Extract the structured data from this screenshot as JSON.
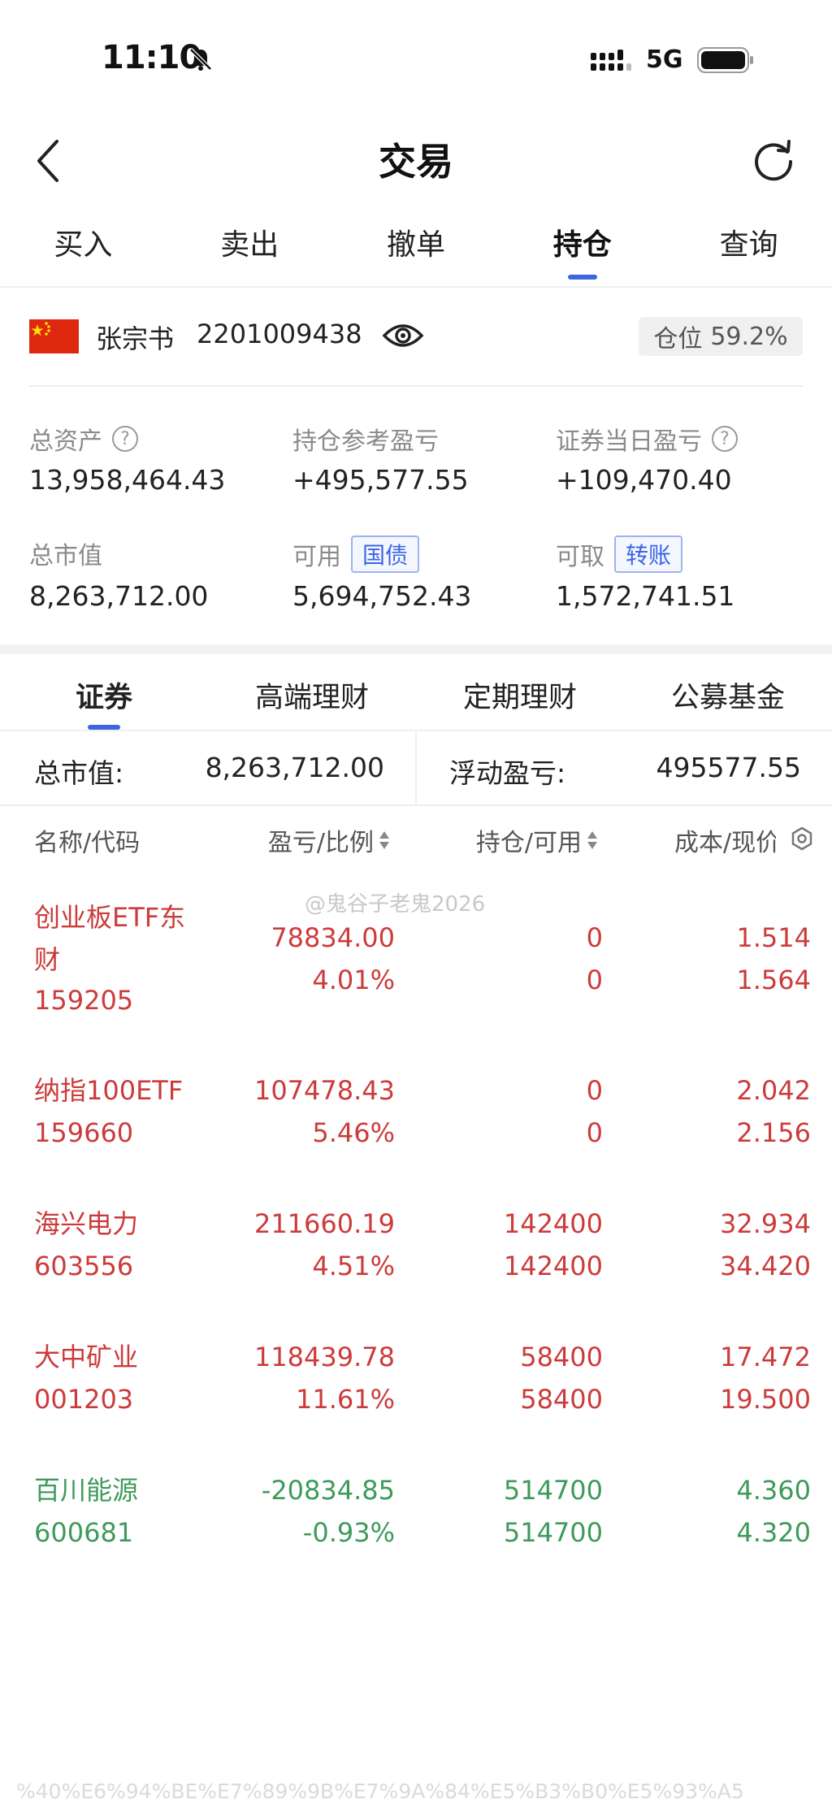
{
  "status": {
    "time": "11:10",
    "network": "5G"
  },
  "header": {
    "title": "交易"
  },
  "tabs": [
    "买入",
    "卖出",
    "撤单",
    "持仓",
    "查询"
  ],
  "active_tab": "持仓",
  "account": {
    "name": "张宗书",
    "number": "2201009438",
    "position_label": "仓位",
    "position_value": "59.2%"
  },
  "summary": {
    "total_assets_label": "总资产",
    "total_assets": "13,958,464.43",
    "holding_pnl_label": "持仓参考盈亏",
    "holding_pnl": "+495,577.55",
    "daily_pnl_label": "证券当日盈亏",
    "daily_pnl": "+109,470.40",
    "market_value_label": "总市值",
    "market_value": "8,263,712.00",
    "available_label": "可用",
    "available_tag": "国债",
    "available": "5,694,752.43",
    "withdrawable_label": "可取",
    "withdrawable_tag": "转账",
    "withdrawable": "1,572,741.51"
  },
  "subtabs": [
    "证券",
    "高端理财",
    "定期理财",
    "公募基金"
  ],
  "totals": {
    "market_value_label": "总市值:",
    "market_value": "8,263,712.00",
    "floating_pnl_label": "浮动盈亏:",
    "floating_pnl": "495577.55"
  },
  "columns": [
    "名称/代码",
    "盈亏/比例",
    "持仓/可用",
    "成本/现价"
  ],
  "watermark": "@鬼谷子老鬼2026",
  "bottom_watermark": "%40%E6%94%BE%E7%89%9B%E7%9A%84%E5%B3%B0%E5%93%A5",
  "holdings": [
    {
      "name_line1": "创业板ETF东",
      "name_line2": "财",
      "code": "159205",
      "pnl": "78834.00",
      "ratio": "4.01%",
      "hold": "0",
      "avail": "0",
      "cost": "1.514",
      "price": "1.564",
      "trend": "up"
    },
    {
      "name_line1": "纳指100ETF",
      "name_line2": "",
      "code": "159660",
      "pnl": "107478.43",
      "ratio": "5.46%",
      "hold": "0",
      "avail": "0",
      "cost": "2.042",
      "price": "2.156",
      "trend": "up"
    },
    {
      "name_line1": "海兴电力",
      "name_line2": "",
      "code": "603556",
      "pnl": "211660.19",
      "ratio": "4.51%",
      "hold": "142400",
      "avail": "142400",
      "cost": "32.934",
      "price": "34.420",
      "trend": "up"
    },
    {
      "name_line1": "大中矿业",
      "name_line2": "",
      "code": "001203",
      "pnl": "118439.78",
      "ratio": "11.61%",
      "hold": "58400",
      "avail": "58400",
      "cost": "17.472",
      "price": "19.500",
      "trend": "up"
    },
    {
      "name_line1": "百川能源",
      "name_line2": "",
      "code": "600681",
      "pnl": "-20834.85",
      "ratio": "-0.93%",
      "hold": "514700",
      "avail": "514700",
      "cost": "4.360",
      "price": "4.320",
      "trend": "down"
    }
  ],
  "colors": {
    "up": "#cc3b3b",
    "down": "#3e9a5a",
    "accent": "#3b66e0"
  }
}
